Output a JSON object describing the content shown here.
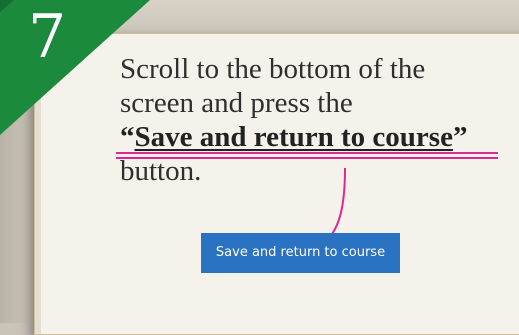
{
  "step": {
    "number": "7"
  },
  "instruction": {
    "line1": "Scroll to the bottom of the",
    "line2": "screen and press the",
    "quote_open": "“",
    "highlight": "Save and return to course",
    "quote_close": "”",
    "line4": "button."
  },
  "button": {
    "label": "Save and return to course"
  },
  "colors": {
    "badge_green": "#1b8a3d",
    "accent_pink": "#e0278f",
    "button_blue": "#2a72c2"
  }
}
